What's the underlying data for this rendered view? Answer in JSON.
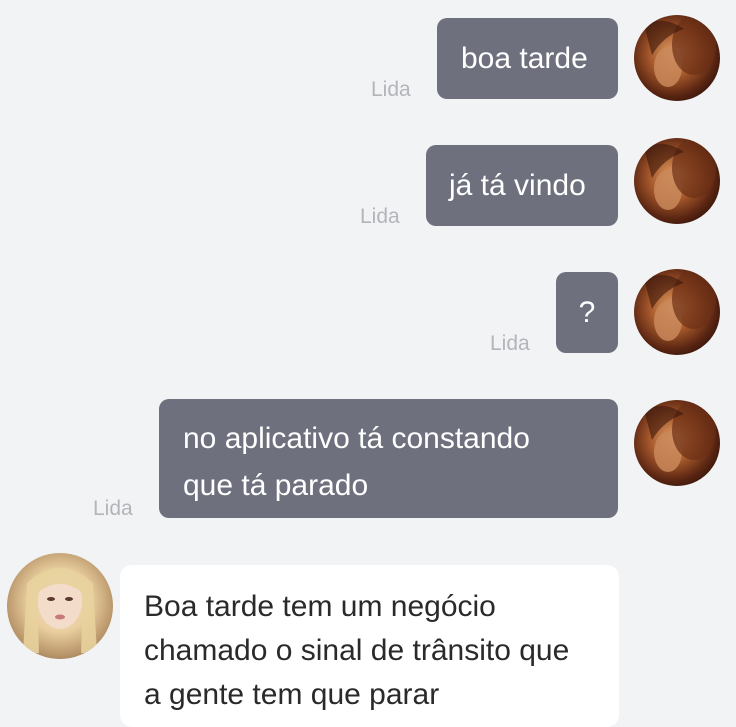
{
  "conversation": {
    "outgoing": [
      {
        "lines": [
          "boa tarde"
        ],
        "status": "Lida"
      },
      {
        "lines": [
          "já tá vindo"
        ],
        "status": "Lida"
      },
      {
        "lines": [
          "?"
        ],
        "status": "Lida"
      },
      {
        "lines": [
          "no aplicativo tá constando",
          "que tá parado"
        ],
        "status": "Lida"
      }
    ],
    "incoming": [
      {
        "lines": [
          "Boa tarde tem um negócio",
          "chamado o sinal de trânsito que",
          "a gente tem que parar"
        ]
      }
    ]
  },
  "colors": {
    "background": "#f2f3f5",
    "outgoing_bubble": "#6e707e",
    "incoming_bubble": "#ffffff",
    "read_status": "#b3b5ba"
  },
  "icons": {
    "sender_avatar": "user-avatar-photo",
    "contact_avatar": "contact-avatar-photo"
  }
}
